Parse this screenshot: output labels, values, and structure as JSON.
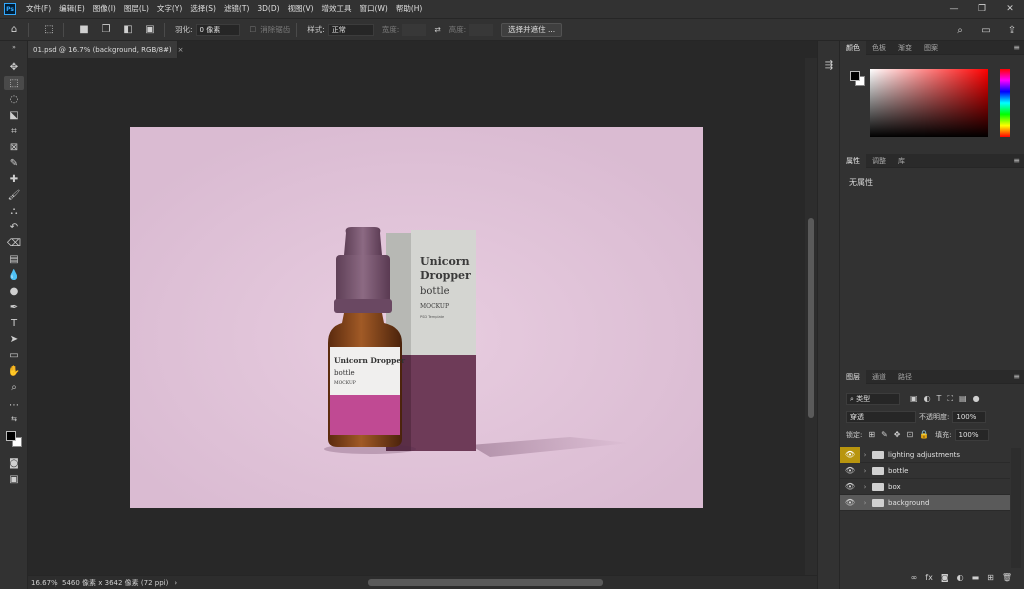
{
  "menu": {
    "logo": "Ps",
    "items": [
      "文件(F)",
      "编辑(E)",
      "图像(I)",
      "图层(L)",
      "文字(Y)",
      "选择(S)",
      "滤镜(T)",
      "3D(D)",
      "视图(V)",
      "增效工具",
      "窗口(W)",
      "帮助(H)"
    ]
  },
  "window_controls": {
    "minimize": "—",
    "maximize": "❐",
    "close": "✕"
  },
  "options_bar": {
    "feather_label": "羽化:",
    "feather_value": "0 像素",
    "antialias_label": "消除锯齿",
    "style_label": "样式:",
    "style_value": "正常",
    "width_label": "宽度:",
    "height_label": "高度:",
    "select_mask_button": "选择并遮住 ..."
  },
  "document_tab": {
    "title": "01.psd @ 16.7% (background, RGB/8#)",
    "close": "×"
  },
  "status": {
    "zoom": "16.67%",
    "doc_info": "5460 像素 x 3642 像素 (72 ppi)",
    "arrow": "›"
  },
  "color_panel": {
    "tabs": [
      "颜色",
      "色板",
      "渐变",
      "图案"
    ]
  },
  "properties_panel": {
    "tabs": [
      "属性",
      "调整",
      "库"
    ],
    "empty_text": "无属性"
  },
  "layers_panel": {
    "tabs": [
      "图层",
      "通道",
      "路径"
    ],
    "filter_kind": "类型",
    "blend_mode": "穿透",
    "opacity_label": "不透明度:",
    "opacity_value": "100%",
    "lock_label": "锁定:",
    "fill_label": "填充:",
    "fill_value": "100%",
    "layers": [
      {
        "name": "lighting adjustments",
        "selected": false,
        "eye_highlight": true
      },
      {
        "name": "bottle",
        "selected": false,
        "eye_highlight": false
      },
      {
        "name": "box",
        "selected": false,
        "eye_highlight": false
      },
      {
        "name": "background",
        "selected": true,
        "eye_highlight": false
      }
    ]
  },
  "product": {
    "box_title_1": "Unicorn",
    "box_title_2": "Dropper",
    "box_subtitle": "bottle",
    "box_mockup": "MOCKUP",
    "box_small": "PSD Template",
    "label_title": "Unicorn Dropper",
    "label_subtitle": "bottle",
    "label_mockup": "MOCKUP"
  },
  "colors": {
    "canvas_bg": "#e2c4da",
    "box_top": "#c9cac6",
    "box_bottom": "#6b3a55",
    "cap": "#7a5670",
    "glass": "#8a4a1f",
    "label_band": "#c04a93",
    "eye_highlight": "#b8950e"
  }
}
